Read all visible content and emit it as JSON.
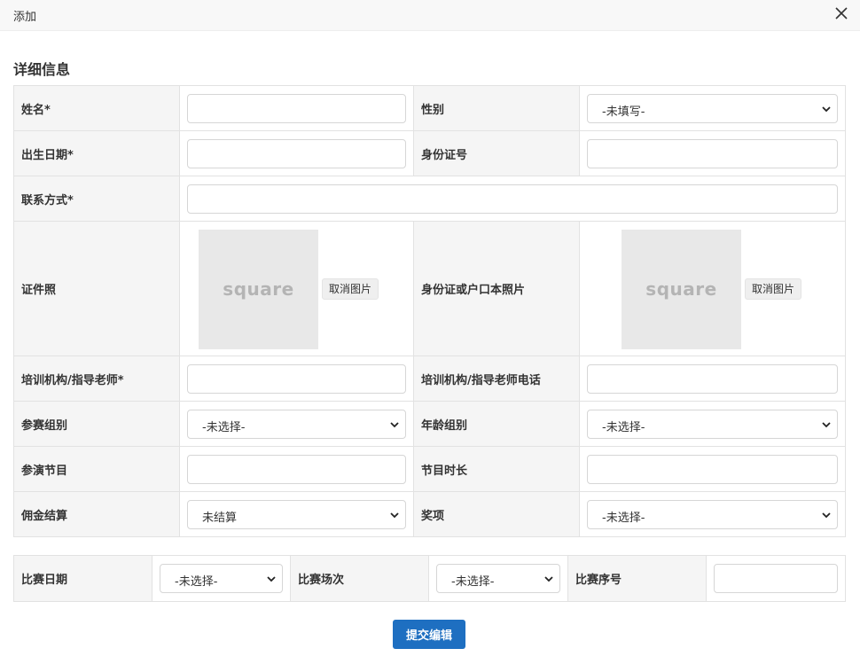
{
  "dialog": {
    "title": "添加",
    "section_title": "详细信息",
    "submit_label": "提交编辑"
  },
  "fields": {
    "name": {
      "label": "姓名*",
      "value": ""
    },
    "gender": {
      "label": "性别",
      "selected": "-未填写-"
    },
    "birthdate": {
      "label": "出生日期*",
      "value": ""
    },
    "id_number": {
      "label": "身份证号",
      "value": ""
    },
    "contact": {
      "label": "联系方式*",
      "value": ""
    },
    "id_photo": {
      "label": "证件照",
      "placeholder_text": "square",
      "cancel_label": "取消图片"
    },
    "id_card_photo": {
      "label": "身份证或户口本照片",
      "placeholder_text": "square",
      "cancel_label": "取消图片"
    },
    "institution": {
      "label": "培训机构/指导老师*",
      "value": ""
    },
    "institution_phone": {
      "label": "培训机构/指导老师电话",
      "value": ""
    },
    "competition_group": {
      "label": "参赛组别",
      "selected": "-未选择-"
    },
    "age_group": {
      "label": "年龄组别",
      "selected": "-未选择-"
    },
    "program": {
      "label": "参演节目",
      "value": ""
    },
    "program_duration": {
      "label": "节目时长",
      "value": ""
    },
    "commission": {
      "label": "佣金结算",
      "selected": "未结算"
    },
    "award": {
      "label": "奖项",
      "selected": "-未选择-"
    }
  },
  "schedule": {
    "date": {
      "label": "比赛日期",
      "selected": "-未选择-"
    },
    "session": {
      "label": "比赛场次",
      "selected": "-未选择-"
    },
    "sequence": {
      "label": "比赛序号",
      "value": ""
    }
  },
  "icons": {
    "close": "close-icon",
    "dropdown": "chevron-down-icon"
  }
}
